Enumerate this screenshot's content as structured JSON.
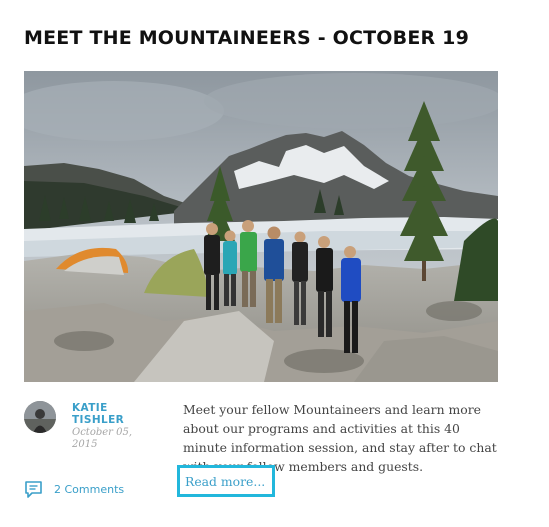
{
  "post": {
    "title": "MEET THE MOUNTAINEERS - OCTOBER 19",
    "hero_alt": "Group of hikers posing on rocks in front of an alpine lake and peaks",
    "author": "KATIE TISHLER",
    "date": "October 05, 2015",
    "excerpt": "Meet your fellow Mountaineers and learn more about our programs and activities at this 40 minute information session, and stay after to chat with your fellow members and guests.",
    "read_more": "Read more...",
    "comments": "2 Comments"
  },
  "colors": {
    "link": "#3a9fc9",
    "highlight_border": "#22b7dc",
    "title": "#111111"
  },
  "icons": {
    "comments": "speech-bubble-icon"
  }
}
